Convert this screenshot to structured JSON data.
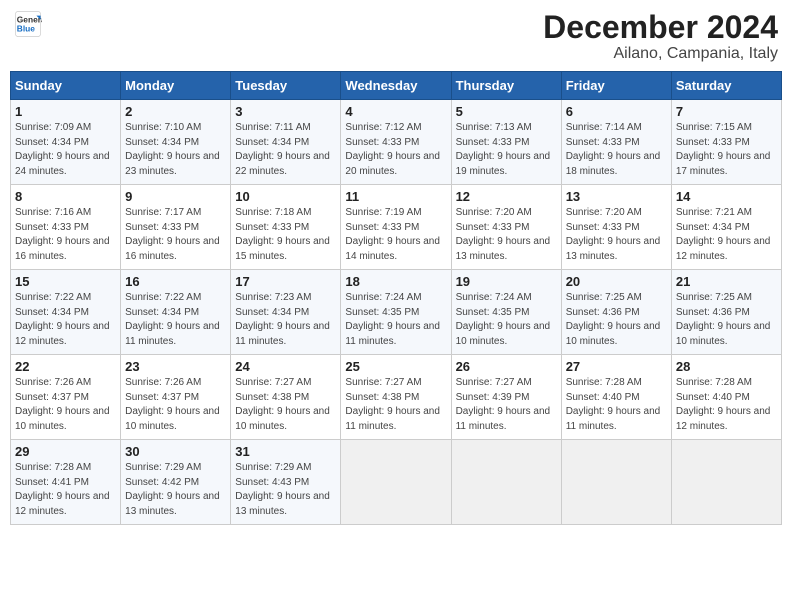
{
  "header": {
    "logo_line1": "General",
    "logo_line2": "Blue",
    "month": "December 2024",
    "location": "Ailano, Campania, Italy"
  },
  "weekdays": [
    "Sunday",
    "Monday",
    "Tuesday",
    "Wednesday",
    "Thursday",
    "Friday",
    "Saturday"
  ],
  "weeks": [
    [
      {
        "day": "1",
        "sunrise": "7:09 AM",
        "sunset": "4:34 PM",
        "daylight": "9 hours and 24 minutes."
      },
      {
        "day": "2",
        "sunrise": "7:10 AM",
        "sunset": "4:34 PM",
        "daylight": "9 hours and 23 minutes."
      },
      {
        "day": "3",
        "sunrise": "7:11 AM",
        "sunset": "4:34 PM",
        "daylight": "9 hours and 22 minutes."
      },
      {
        "day": "4",
        "sunrise": "7:12 AM",
        "sunset": "4:33 PM",
        "daylight": "9 hours and 20 minutes."
      },
      {
        "day": "5",
        "sunrise": "7:13 AM",
        "sunset": "4:33 PM",
        "daylight": "9 hours and 19 minutes."
      },
      {
        "day": "6",
        "sunrise": "7:14 AM",
        "sunset": "4:33 PM",
        "daylight": "9 hours and 18 minutes."
      },
      {
        "day": "7",
        "sunrise": "7:15 AM",
        "sunset": "4:33 PM",
        "daylight": "9 hours and 17 minutes."
      }
    ],
    [
      {
        "day": "8",
        "sunrise": "7:16 AM",
        "sunset": "4:33 PM",
        "daylight": "9 hours and 16 minutes."
      },
      {
        "day": "9",
        "sunrise": "7:17 AM",
        "sunset": "4:33 PM",
        "daylight": "9 hours and 16 minutes."
      },
      {
        "day": "10",
        "sunrise": "7:18 AM",
        "sunset": "4:33 PM",
        "daylight": "9 hours and 15 minutes."
      },
      {
        "day": "11",
        "sunrise": "7:19 AM",
        "sunset": "4:33 PM",
        "daylight": "9 hours and 14 minutes."
      },
      {
        "day": "12",
        "sunrise": "7:20 AM",
        "sunset": "4:33 PM",
        "daylight": "9 hours and 13 minutes."
      },
      {
        "day": "13",
        "sunrise": "7:20 AM",
        "sunset": "4:33 PM",
        "daylight": "9 hours and 13 minutes."
      },
      {
        "day": "14",
        "sunrise": "7:21 AM",
        "sunset": "4:34 PM",
        "daylight": "9 hours and 12 minutes."
      }
    ],
    [
      {
        "day": "15",
        "sunrise": "7:22 AM",
        "sunset": "4:34 PM",
        "daylight": "9 hours and 12 minutes."
      },
      {
        "day": "16",
        "sunrise": "7:22 AM",
        "sunset": "4:34 PM",
        "daylight": "9 hours and 11 minutes."
      },
      {
        "day": "17",
        "sunrise": "7:23 AM",
        "sunset": "4:34 PM",
        "daylight": "9 hours and 11 minutes."
      },
      {
        "day": "18",
        "sunrise": "7:24 AM",
        "sunset": "4:35 PM",
        "daylight": "9 hours and 11 minutes."
      },
      {
        "day": "19",
        "sunrise": "7:24 AM",
        "sunset": "4:35 PM",
        "daylight": "9 hours and 10 minutes."
      },
      {
        "day": "20",
        "sunrise": "7:25 AM",
        "sunset": "4:36 PM",
        "daylight": "9 hours and 10 minutes."
      },
      {
        "day": "21",
        "sunrise": "7:25 AM",
        "sunset": "4:36 PM",
        "daylight": "9 hours and 10 minutes."
      }
    ],
    [
      {
        "day": "22",
        "sunrise": "7:26 AM",
        "sunset": "4:37 PM",
        "daylight": "9 hours and 10 minutes."
      },
      {
        "day": "23",
        "sunrise": "7:26 AM",
        "sunset": "4:37 PM",
        "daylight": "9 hours and 10 minutes."
      },
      {
        "day": "24",
        "sunrise": "7:27 AM",
        "sunset": "4:38 PM",
        "daylight": "9 hours and 10 minutes."
      },
      {
        "day": "25",
        "sunrise": "7:27 AM",
        "sunset": "4:38 PM",
        "daylight": "9 hours and 11 minutes."
      },
      {
        "day": "26",
        "sunrise": "7:27 AM",
        "sunset": "4:39 PM",
        "daylight": "9 hours and 11 minutes."
      },
      {
        "day": "27",
        "sunrise": "7:28 AM",
        "sunset": "4:40 PM",
        "daylight": "9 hours and 11 minutes."
      },
      {
        "day": "28",
        "sunrise": "7:28 AM",
        "sunset": "4:40 PM",
        "daylight": "9 hours and 12 minutes."
      }
    ],
    [
      {
        "day": "29",
        "sunrise": "7:28 AM",
        "sunset": "4:41 PM",
        "daylight": "9 hours and 12 minutes."
      },
      {
        "day": "30",
        "sunrise": "7:29 AM",
        "sunset": "4:42 PM",
        "daylight": "9 hours and 13 minutes."
      },
      {
        "day": "31",
        "sunrise": "7:29 AM",
        "sunset": "4:43 PM",
        "daylight": "9 hours and 13 minutes."
      },
      null,
      null,
      null,
      null
    ]
  ]
}
